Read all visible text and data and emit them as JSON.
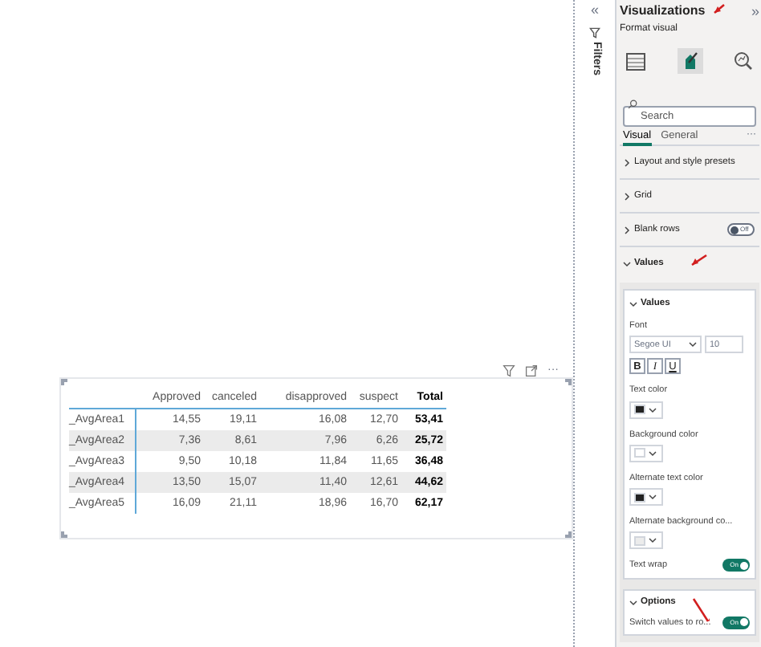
{
  "visual_header": {
    "more": "···"
  },
  "table": {
    "columns": [
      "Approved",
      "canceled",
      "disapproved",
      "suspect",
      "Total"
    ],
    "rows": [
      {
        "label": "_AvgArea1",
        "values": [
          "14,55",
          "19,11",
          "16,08",
          "12,70",
          "53,41"
        ]
      },
      {
        "label": "_AvgArea2",
        "values": [
          "7,36",
          "8,61",
          "7,96",
          "6,26",
          "25,72"
        ]
      },
      {
        "label": "_AvgArea3",
        "values": [
          "9,50",
          "10,18",
          "11,84",
          "11,65",
          "36,48"
        ]
      },
      {
        "label": "_AvgArea4",
        "values": [
          "13,50",
          "15,07",
          "11,40",
          "12,61",
          "44,62"
        ]
      },
      {
        "label": "_AvgArea5",
        "values": [
          "16,09",
          "21,11",
          "18,96",
          "16,70",
          "62,17"
        ]
      }
    ]
  },
  "filters_pane": {
    "collapse": "«",
    "title": "Filters"
  },
  "visualizations": {
    "title": "Visualizations",
    "expand": "»",
    "subtitle": "Format visual",
    "search": {
      "placeholder": "Search"
    },
    "tabs": [
      {
        "label": "Visual",
        "selected": true
      },
      {
        "label": "General",
        "selected": false
      }
    ],
    "tabs_more": "···",
    "sections": [
      {
        "label": "Layout and style presets",
        "expanded": false
      },
      {
        "label": "Grid",
        "expanded": false
      },
      {
        "label": "Blank rows",
        "expanded": false,
        "toggle": {
          "on": false,
          "label": "Off"
        }
      },
      {
        "label": "Values",
        "expanded": true
      }
    ],
    "values_card": {
      "title": "Values",
      "expanded": true,
      "font_label": "Font",
      "font": "Segoe UI",
      "size": "10",
      "styles": [
        {
          "label": "B",
          "kind": "bold"
        },
        {
          "label": "I",
          "kind": "italic"
        },
        {
          "label": "U",
          "kind": "underline"
        }
      ],
      "colors": [
        {
          "label": "Text color",
          "color": "#222222"
        },
        {
          "label": "Background color",
          "color": "#ffffff"
        },
        {
          "label": "Alternate text color",
          "color": "#222222"
        },
        {
          "label": "Alternate background co...",
          "color": "#ececec"
        }
      ],
      "text_wrap": {
        "label": "Text wrap",
        "on": true,
        "state": "On"
      }
    },
    "options_card": {
      "title": "Options",
      "expanded": true,
      "switch": {
        "label": "Switch values to ro...",
        "on": true,
        "state": "On"
      }
    }
  }
}
